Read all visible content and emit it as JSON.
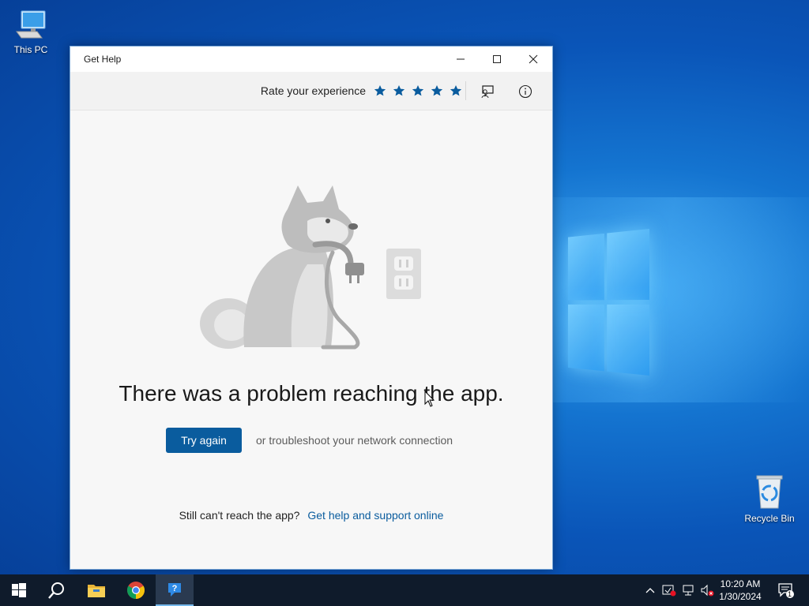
{
  "desktop": {
    "icons": [
      {
        "label": "This PC",
        "icon": "this-pc-icon"
      },
      {
        "label": "Recycle Bin",
        "icon": "recycle-bin-icon"
      }
    ]
  },
  "window": {
    "title": "Get Help",
    "controls": {
      "minimize": "minimize-icon",
      "maximize": "maximize-icon",
      "close": "close-icon"
    },
    "toolbar": {
      "rate_label": "Rate your experience",
      "stars": 5,
      "feedback_icon": "feedback-icon",
      "info_icon": "info-icon"
    },
    "error": {
      "headline": "There was a problem reaching the app.",
      "try_again": "Try again",
      "troubleshoot": "or troubleshoot your network connection",
      "still_text": "Still can't reach the app?",
      "help_link": "Get help and support online"
    }
  },
  "taskbar": {
    "items": [
      "start-icon",
      "search-icon",
      "file-explorer-icon",
      "chrome-icon",
      "get-help-icon"
    ],
    "active": "get-help-icon",
    "time": "10:20 AM",
    "date": "1/30/2024",
    "notification_count": "1"
  },
  "colors": {
    "accent": "#0a5c9e",
    "star": "#0a5c9e",
    "taskbar": "#0f1b2b"
  }
}
